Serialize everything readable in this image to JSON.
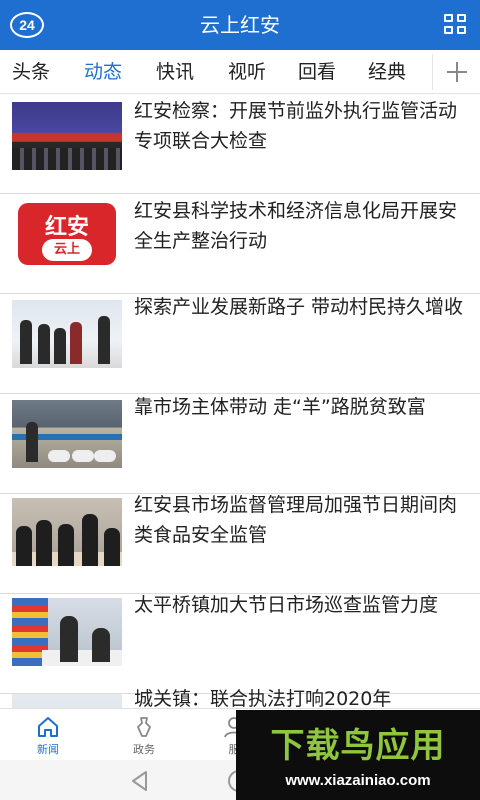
{
  "header": {
    "logo_text": "24",
    "title": "云上红安",
    "bg_color": "#1f6fd0"
  },
  "tabs": [
    {
      "label": "头条",
      "active": false
    },
    {
      "label": "动态",
      "active": true
    },
    {
      "label": "快讯",
      "active": false
    },
    {
      "label": "视听",
      "active": false
    },
    {
      "label": "回看",
      "active": false
    },
    {
      "label": "经典",
      "active": false
    }
  ],
  "news": [
    {
      "title": "红安检察：开展节前监外执行监管活动专项联合大检查",
      "thumb_icon": "meeting-photo"
    },
    {
      "title": "红安县科学技术和经济信息化局开展安全生产整治行动",
      "thumb_icon": "hongan-cloud-logo",
      "logo_text_top": "红安",
      "logo_text_bottom": "云上"
    },
    {
      "title": "探索产业发展新路子 带动村民持久增收",
      "thumb_icon": "village-photo"
    },
    {
      "title": "靠市场主体带动  走“羊”路脱贫致富",
      "thumb_icon": "sheep-photo"
    },
    {
      "title": "红安县市场监督管理局加强节日期间肉类食品安全监管",
      "thumb_icon": "market-photo"
    },
    {
      "title": "太平桥镇加大节日市场巡查监管力度",
      "thumb_icon": "inspection-photo"
    },
    {
      "title": "城关镇：联合执法打响2020年",
      "thumb_icon": "road-photo"
    }
  ],
  "bottom_nav": [
    {
      "label": "新闻",
      "icon": "home-icon",
      "active": true
    },
    {
      "label": "政务",
      "icon": "badge-icon",
      "active": false
    },
    {
      "label": "服",
      "icon": "user-icon",
      "active": false
    }
  ],
  "watermark": {
    "title": "下载鸟应用",
    "url": "www.xiazainiao.com"
  }
}
